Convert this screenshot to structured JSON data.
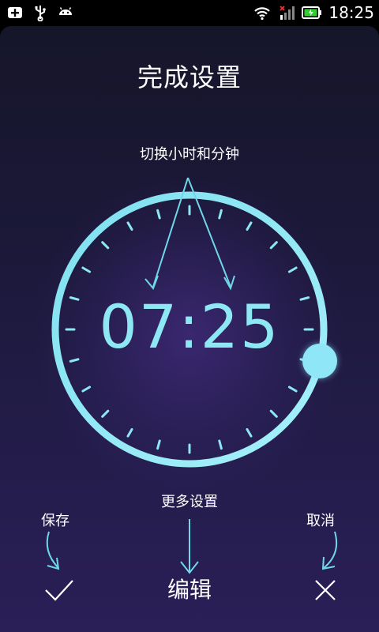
{
  "status_bar": {
    "time": "18:25",
    "left_icons": [
      "add-icon",
      "usb-icon",
      "android-icon"
    ],
    "right_icons": [
      "wifi-icon",
      "signal-icon",
      "battery-icon"
    ]
  },
  "screen": {
    "title": "完成设置",
    "hint_switch": "切换小时和分钟",
    "time_display": "07:25",
    "hint_more": "更多设置",
    "hint_save": "保存",
    "hint_cancel": "取消",
    "edit_label": "编辑"
  },
  "colors": {
    "accent": "#8ee8f4",
    "background_top": "#16162a",
    "background_bottom": "#2a1f57",
    "text": "#ffffff"
  },
  "icons": {
    "confirm": "checkmark-icon",
    "cancel": "close-icon"
  }
}
